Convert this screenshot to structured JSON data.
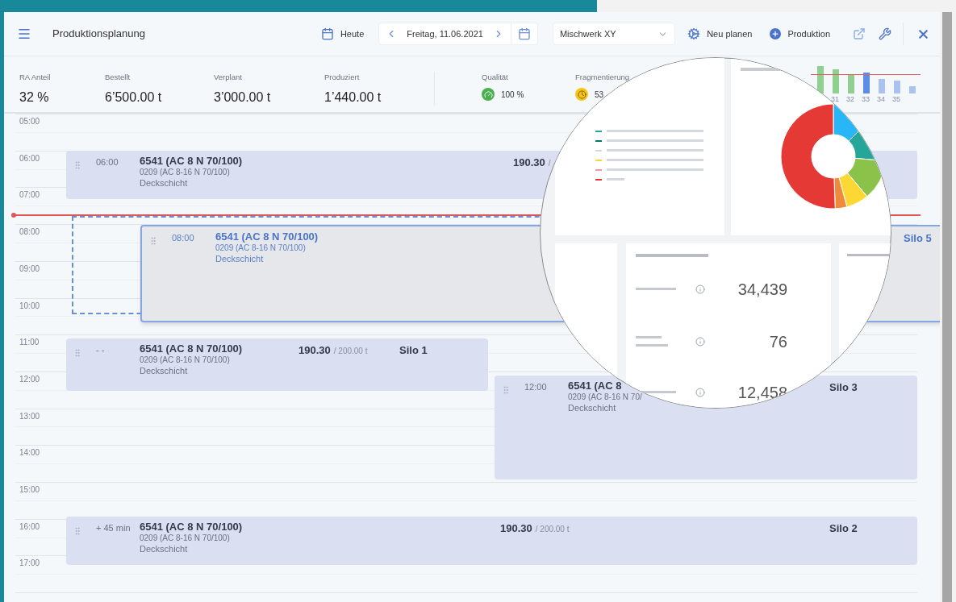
{
  "header": {
    "title": "Produktionsplanung",
    "today": "Heute",
    "date": "Freitag, 11.06.2021",
    "plant": "Mischwerk XY",
    "actions": [
      {
        "label": "Neu planen",
        "kind": "replan"
      },
      {
        "label": "Produktion",
        "kind": "add"
      }
    ]
  },
  "stats": [
    {
      "label": "RA Anteil",
      "value": "32 %",
      "kind": "plain"
    },
    {
      "label": "Bestellt",
      "value": "6’500.00 t",
      "kind": "plain"
    },
    {
      "label": "Verplant",
      "value": "3’000.00 t",
      "kind": "plain"
    },
    {
      "label": "Produziert",
      "value": "1’440.00 t",
      "kind": "plain"
    },
    {
      "label": "Qualität",
      "value": "100 %",
      "kind": "quality",
      "color": "#4caf50"
    },
    {
      "label": "Fragmentierung",
      "value": "53",
      "kind": "fragmentation",
      "color": "#f5c518"
    }
  ],
  "week_bars": {
    "labels": [
      "31",
      "32",
      "33",
      "34",
      "35"
    ]
  },
  "timeline": {
    "hours": [
      "05:00",
      "06:00",
      "07:00",
      "08:00",
      "09:00",
      "10:00",
      "11:00",
      "12:00",
      "13:00",
      "14:00",
      "15:00",
      "16:00",
      "17:00"
    ]
  },
  "orders": [
    {
      "kind": "placed",
      "time": "06:00",
      "title": "6541 (AC 8 N 70/100)",
      "batch": "0209 (AC 8-16 N 70/100)",
      "layer": "Deckschicht",
      "amount": "190.30",
      "total": "/"
    },
    {
      "kind": "dragging",
      "time": "08:00",
      "title": "6541 (AC 8 N 70/100)",
      "batch": "0209 (AC 8-16 N 70/100)",
      "layer": "Deckschicht",
      "silo": "Silo 5"
    },
    {
      "kind": "placed",
      "time": "- -",
      "title": "6541 (AC 8 N 70/100)",
      "batch": "0209 (AC 8-16 N 70/100)",
      "layer": "Deckschicht",
      "amount": "190.30",
      "total": "/ 200.00 t",
      "silo": "Silo 1"
    },
    {
      "kind": "placed",
      "time": "12:00",
      "title": "6541 (AC 8",
      "batch": "0209 (AC 8-16 N 70/",
      "layer": "Deckschicht",
      "silo": "Silo 3"
    },
    {
      "kind": "placed",
      "time": "+ 45 min",
      "title": "6541 (AC 8 N 70/100)",
      "batch": "0209 (AC 8-16 N 70/100)",
      "layer": "Deckschicht",
      "amount": "190.30",
      "total": "/ 200.00 t",
      "silo": "Silo 2"
    }
  ],
  "magnifier": {
    "metrics": [
      {
        "value": "34,439"
      },
      {
        "value": "76"
      },
      {
        "value": "12,458"
      }
    ]
  }
}
